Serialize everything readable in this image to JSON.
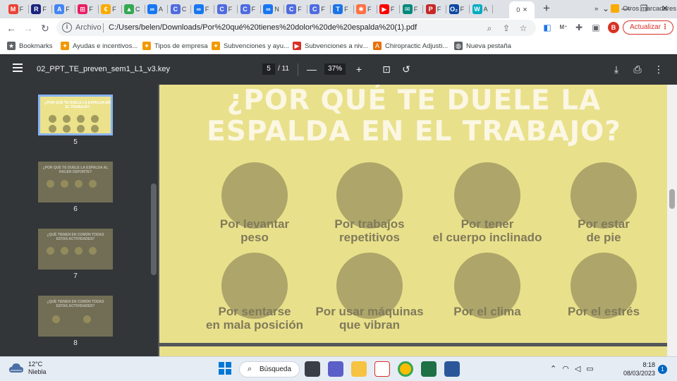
{
  "browser": {
    "tabs": [
      {
        "icon": "gmail-icon",
        "label": "M",
        "title": "F",
        "color": "#ea4335"
      },
      {
        "icon": "r-icon",
        "label": "R",
        "title": "F",
        "color": "#1a237e"
      },
      {
        "icon": "font-a-icon",
        "label": "A",
        "title": "F",
        "color": "#4285f4"
      },
      {
        "icon": "grid-icon",
        "label": "⊞",
        "title": "F",
        "color": "#e91e63"
      },
      {
        "icon": "coin-icon",
        "label": "€",
        "title": "F",
        "color": "#f9ab00"
      },
      {
        "icon": "drive-icon",
        "label": "▲",
        "title": "C",
        "color": "#34a853"
      },
      {
        "icon": "meta-icon",
        "label": "∞",
        "title": "A",
        "color": "#1877f2"
      },
      {
        "icon": "c-icon",
        "label": "C",
        "title": "C",
        "color": "#4f6bdf"
      },
      {
        "icon": "meta-icon",
        "label": "∞",
        "title": "F",
        "color": "#1877f2"
      },
      {
        "icon": "c-icon",
        "label": "C",
        "title": "F",
        "color": "#4f6bdf"
      },
      {
        "icon": "c-icon",
        "label": "C",
        "title": "F",
        "color": "#4f6bdf"
      },
      {
        "icon": "meta-icon",
        "label": "∞",
        "title": "N",
        "color": "#1877f2"
      },
      {
        "icon": "c-icon",
        "label": "C",
        "title": "F",
        "color": "#4f6bdf"
      },
      {
        "icon": "c-icon",
        "label": "C",
        "title": "F",
        "color": "#4f6bdf"
      },
      {
        "icon": "t-icon",
        "label": "T",
        "title": "F",
        "color": "#1a73e8"
      },
      {
        "icon": "puzzle-icon",
        "label": "✱",
        "title": "F",
        "color": "#ff7043"
      },
      {
        "icon": "youtube-icon",
        "label": "▶",
        "title": "F",
        "color": "#ff0000"
      },
      {
        "icon": "mail-icon",
        "label": "✉",
        "title": "F",
        "color": "#00897b"
      },
      {
        "icon": "p-icon",
        "label": "P",
        "title": "F",
        "color": "#c62828"
      },
      {
        "icon": "o2-icon",
        "label": "O₂",
        "title": "F",
        "color": "#0d47a1"
      },
      {
        "icon": "w-icon",
        "label": "W",
        "title": "A",
        "color": "#00acc1"
      }
    ],
    "active_tab": {
      "title": "0",
      "close": "×"
    },
    "new_tab": "+",
    "window_controls": [
      "⌄",
      "—",
      "❐",
      "✕"
    ],
    "nav": {
      "back": "←",
      "forward": "→",
      "reload": "↻"
    },
    "address": {
      "scheme_label": "Archivo",
      "url": "C:/Users/belen/Downloads/Por%20qué%20tienes%20dolor%20de%20espalda%20(1).pdf"
    },
    "omni_icons": [
      "zoom-icon",
      "share-icon",
      "star-icon"
    ],
    "profile_initial": "B",
    "update_label": "Actualizar",
    "update_menu": "⋮",
    "bookmarks": [
      {
        "label": "Bookmarks",
        "icon": "★",
        "color": "#5f6368"
      },
      {
        "label": "Ayudas e incentivos...",
        "icon": "✦",
        "color": "#f29900"
      },
      {
        "label": "Tipos de empresa",
        "icon": "✦",
        "color": "#f29900"
      },
      {
        "label": "Subvenciones y ayu...",
        "icon": "✦",
        "color": "#f29900"
      },
      {
        "label": "Subvenciones a niv...",
        "icon": "▶",
        "color": "#d93025"
      },
      {
        "label": "Chiropractic Adjusti...",
        "icon": "A",
        "color": "#e8710a"
      },
      {
        "label": "Nueva pestaña",
        "icon": "◍",
        "color": "#5f6368"
      }
    ],
    "bookmarks_more": "»",
    "other_bookmarks": "Otros marcadores"
  },
  "pdf": {
    "file_title": "02_PPT_TE_preven_sem1_L1_v3.key",
    "current_page": "5",
    "total_pages": "/ 11",
    "zoom": "37%",
    "zoom_out": "—",
    "zoom_in": "+",
    "thumbnails": [
      {
        "page": "5",
        "title": "¿POR QUÉ TE DUELE LA ESPALDA EN EL TRABAJO?",
        "selected": true
      },
      {
        "page": "6",
        "title": "¿POR QUÉ TE DUELE LA ESPALDA AL HACER DEPORTE?",
        "selected": false
      },
      {
        "page": "7",
        "title": "¿QUÉ TIENEN EN COMÚN TODAS ESTAS ACTIVIDADES?",
        "selected": false
      },
      {
        "page": "8",
        "title": "¿QUÉ TIENEN EN COMÚN TODAS ESTAS ACTIVIDADES?",
        "selected": false
      }
    ],
    "slide": {
      "title_line1": "¿POR QUÉ TE DUELE LA",
      "title_line2": "ESPALDA EN EL TRABAJO?",
      "items": [
        {
          "line1": "Por levantar",
          "line2": "peso"
        },
        {
          "line1": "Por trabajos",
          "line2": "repetitivos"
        },
        {
          "line1": "Por tener",
          "line2": "el cuerpo inclinado"
        },
        {
          "line1": "Por estar",
          "line2": "de pie"
        },
        {
          "line1": "Por sentarse",
          "line2": "en mala posición"
        },
        {
          "line1": "Por usar máquinas",
          "line2": "que vibran"
        },
        {
          "line1": "Por el clima",
          "line2": ""
        },
        {
          "line1": "Por el estrés",
          "line2": ""
        }
      ]
    }
  },
  "taskbar": {
    "weather_temp": "12°C",
    "weather_desc": "Niebla",
    "search_label": "Búsqueda",
    "time": "8:18",
    "date": "08/03/2023",
    "notification_count": "1"
  }
}
